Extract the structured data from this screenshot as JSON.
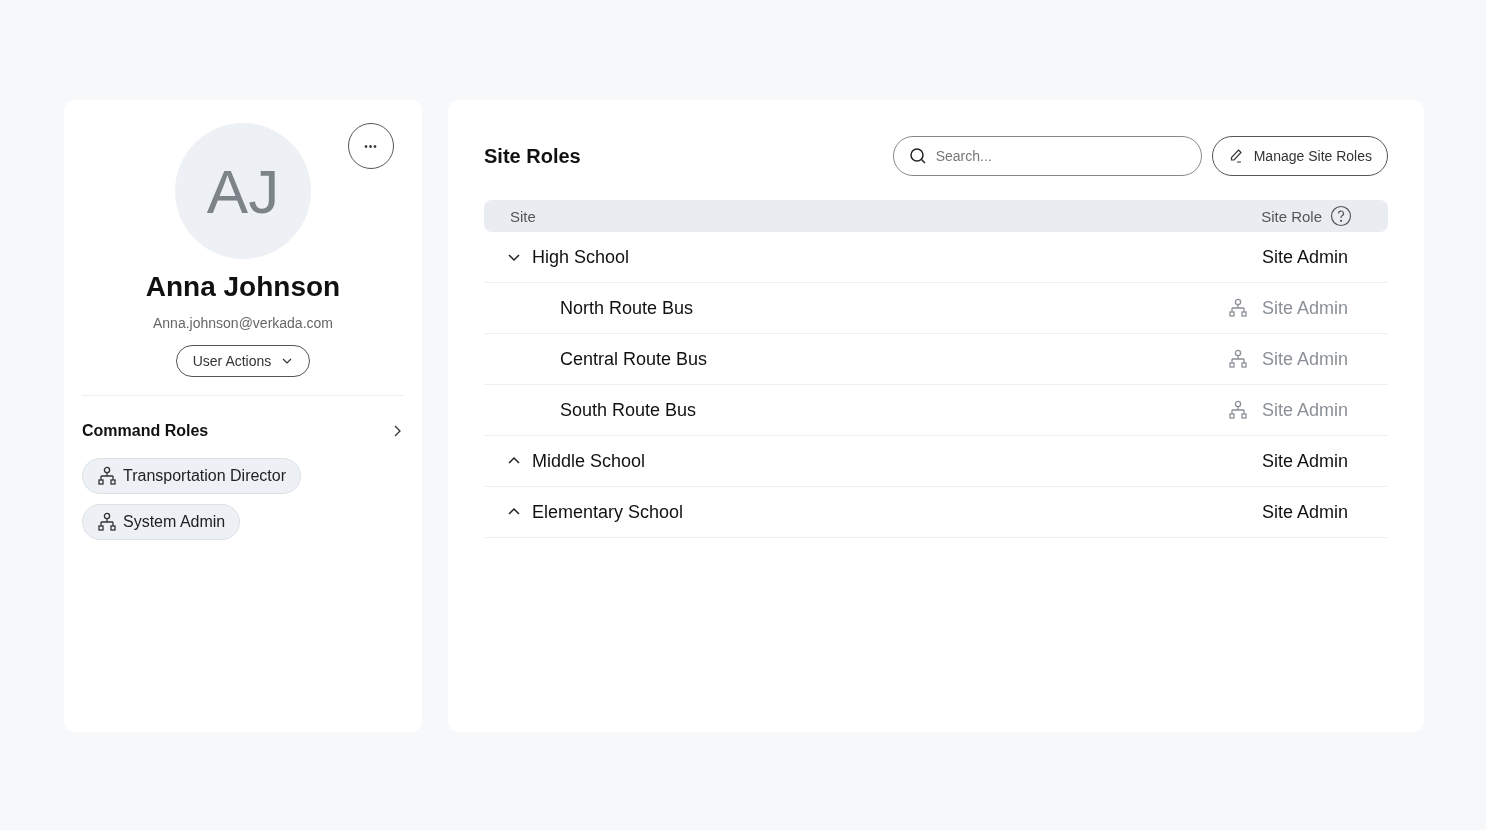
{
  "profile": {
    "initials": "AJ",
    "name": "Anna Johnson",
    "email": "Anna.johnson@verkada.com",
    "actions_button": "User Actions",
    "more_button": "•••"
  },
  "command_roles": {
    "title": "Command Roles",
    "roles": [
      "Transportation Director",
      "System Admin"
    ]
  },
  "site_roles": {
    "title": "Site Roles",
    "search": {
      "placeholder": "Search..."
    },
    "manage_button": "Manage Site Roles",
    "columns": [
      "Site",
      "Site Role"
    ],
    "rows": [
      {
        "site": "High School",
        "role": "Site Admin",
        "inherited": false,
        "expanded": true,
        "children": [
          {
            "site": "North Route Bus",
            "role": "Site Admin",
            "inherited": true
          },
          {
            "site": "Central Route Bus",
            "role": "Site Admin",
            "inherited": true
          },
          {
            "site": "South Route Bus",
            "role": "Site Admin",
            "inherited": true
          }
        ]
      },
      {
        "site": "Middle School",
        "role": "Site Admin",
        "inherited": false,
        "expanded": false
      },
      {
        "site": "Elementary School",
        "role": "Site Admin",
        "inherited": false,
        "expanded": false
      }
    ]
  }
}
